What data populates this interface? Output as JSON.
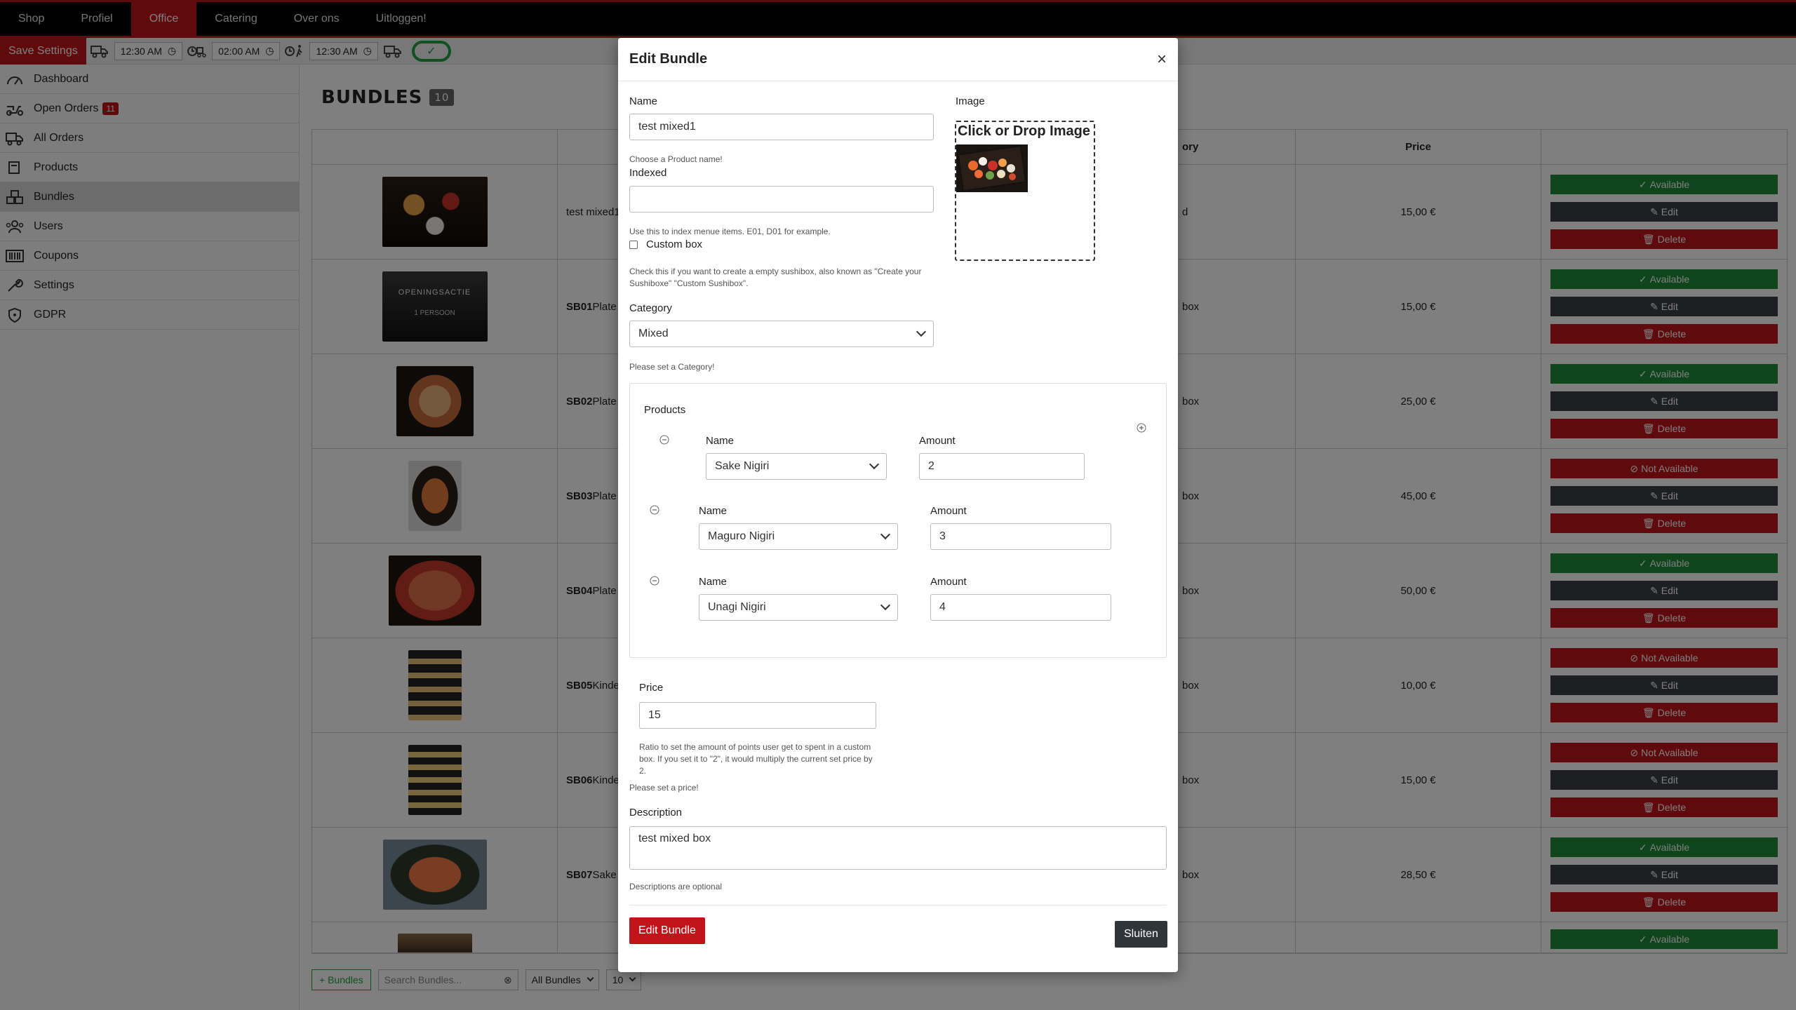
{
  "topnav": {
    "items": [
      {
        "label": "Shop"
      },
      {
        "label": "Profiel"
      },
      {
        "label": "Office",
        "active": true
      },
      {
        "label": "Catering"
      },
      {
        "label": "Over ons"
      },
      {
        "label": "Uitloggen!"
      }
    ]
  },
  "settings": {
    "save_label": "Save Settings",
    "time1": "12:30 AM",
    "time2": "02:00 AM",
    "time3": "12:30 AM",
    "toggle_on": true,
    "accent": "#c0141a",
    "success": "#1e8a34"
  },
  "sidebar": {
    "items": [
      {
        "label": "Dashboard",
        "icon": "gauge-icon"
      },
      {
        "label": "Open Orders",
        "icon": "delivery-scooter-icon",
        "badge": "11"
      },
      {
        "label": "All Orders",
        "icon": "truck-icon"
      },
      {
        "label": "Products",
        "icon": "box-icon"
      },
      {
        "label": "Bundles",
        "icon": "boxes-icon",
        "active": true
      },
      {
        "label": "Users",
        "icon": "users-icon"
      },
      {
        "label": "Coupons",
        "icon": "barcode-icon"
      },
      {
        "label": "Settings",
        "icon": "wrench-icon"
      },
      {
        "label": "GDPR",
        "icon": "shield-icon"
      }
    ]
  },
  "page": {
    "title": "BUNDLES",
    "count": "10",
    "headers": {
      "category": "ory",
      "price": "Price"
    }
  },
  "rows": [
    {
      "code": "",
      "name": "test mixed1",
      "category": "d",
      "price": "15,00 €",
      "status": "Available",
      "img": "a"
    },
    {
      "code": "SB01",
      "name": "Plate",
      "category": "box",
      "price": "15,00 €",
      "status": "Available",
      "img": "b",
      "img_title": "OPENINGSACTIE",
      "img_subtitle": "1 PERSOON"
    },
    {
      "code": "SB02",
      "name": "Plate",
      "category": "box",
      "price": "25,00 €",
      "status": "Available",
      "img": "c"
    },
    {
      "code": "SB03",
      "name": "Plate",
      "category": "box",
      "price": "45,00 €",
      "status": "Not Available",
      "img": "d"
    },
    {
      "code": "SB04",
      "name": "Plate",
      "category": "box",
      "price": "50,00 €",
      "status": "Available",
      "img": "e"
    },
    {
      "code": "SB05",
      "name": "Kinde",
      "category": "box",
      "price": "10,00 €",
      "status": "Not Available",
      "img": "f"
    },
    {
      "code": "SB06",
      "name": "Kinde",
      "category": "box",
      "price": "15,00 €",
      "status": "Not Available",
      "img": "g"
    },
    {
      "code": "SB07",
      "name": "Sake S",
      "category": "box",
      "price": "28,50 €",
      "status": "Available",
      "img": "h"
    }
  ],
  "row_actions": {
    "edit": "Edit",
    "delete": "Delete"
  },
  "last_row_status": "Available",
  "footer": {
    "add_label": "Bundles",
    "search_placeholder": "Search Bundles...",
    "filter": "All Bundles",
    "page_size": "10"
  },
  "modal": {
    "title": "Edit Bundle",
    "name_label": "Name",
    "name_value": "test mixed1",
    "name_hint": "Choose a Product name!",
    "indexed_label": "Indexed",
    "indexed_value": "",
    "indexed_hint": "Use this to index menue items. E01, D01 for example.",
    "custom_label": "Custom box",
    "custom_hint": "Check this if you want to create a empty sushibox, also known as \"Create your Sushiboxe\" \"Custom Sushibox\".",
    "image_label": "Image",
    "dropzone_text": "Click or Drop Image",
    "category_label": "Category",
    "category_value": "Mixed",
    "category_hint": "Please set a Category!",
    "products_label": "Products",
    "products": [
      {
        "name_label": "Name",
        "name": "Sake Nigiri",
        "amount_label": "Amount",
        "amount": "2"
      },
      {
        "name_label": "Name",
        "name": "Maguro Nigiri",
        "amount_label": "Amount",
        "amount": "3"
      },
      {
        "name_label": "Name",
        "name": "Unagi Nigiri",
        "amount_label": "Amount",
        "amount": "4"
      }
    ],
    "price_label": "Price",
    "price_value": "15",
    "ratio_hint": "Ratio to set the amount of points user get to spent in a custom box. If you set it to \"2\", it would multiply the current set price by 2.",
    "price_hint": "Please set a price!",
    "description_label": "Description",
    "description_value": "test mixed box",
    "description_hint": "Descriptions are optional",
    "submit_label": "Edit Bundle",
    "close_label": "Sluiten"
  }
}
